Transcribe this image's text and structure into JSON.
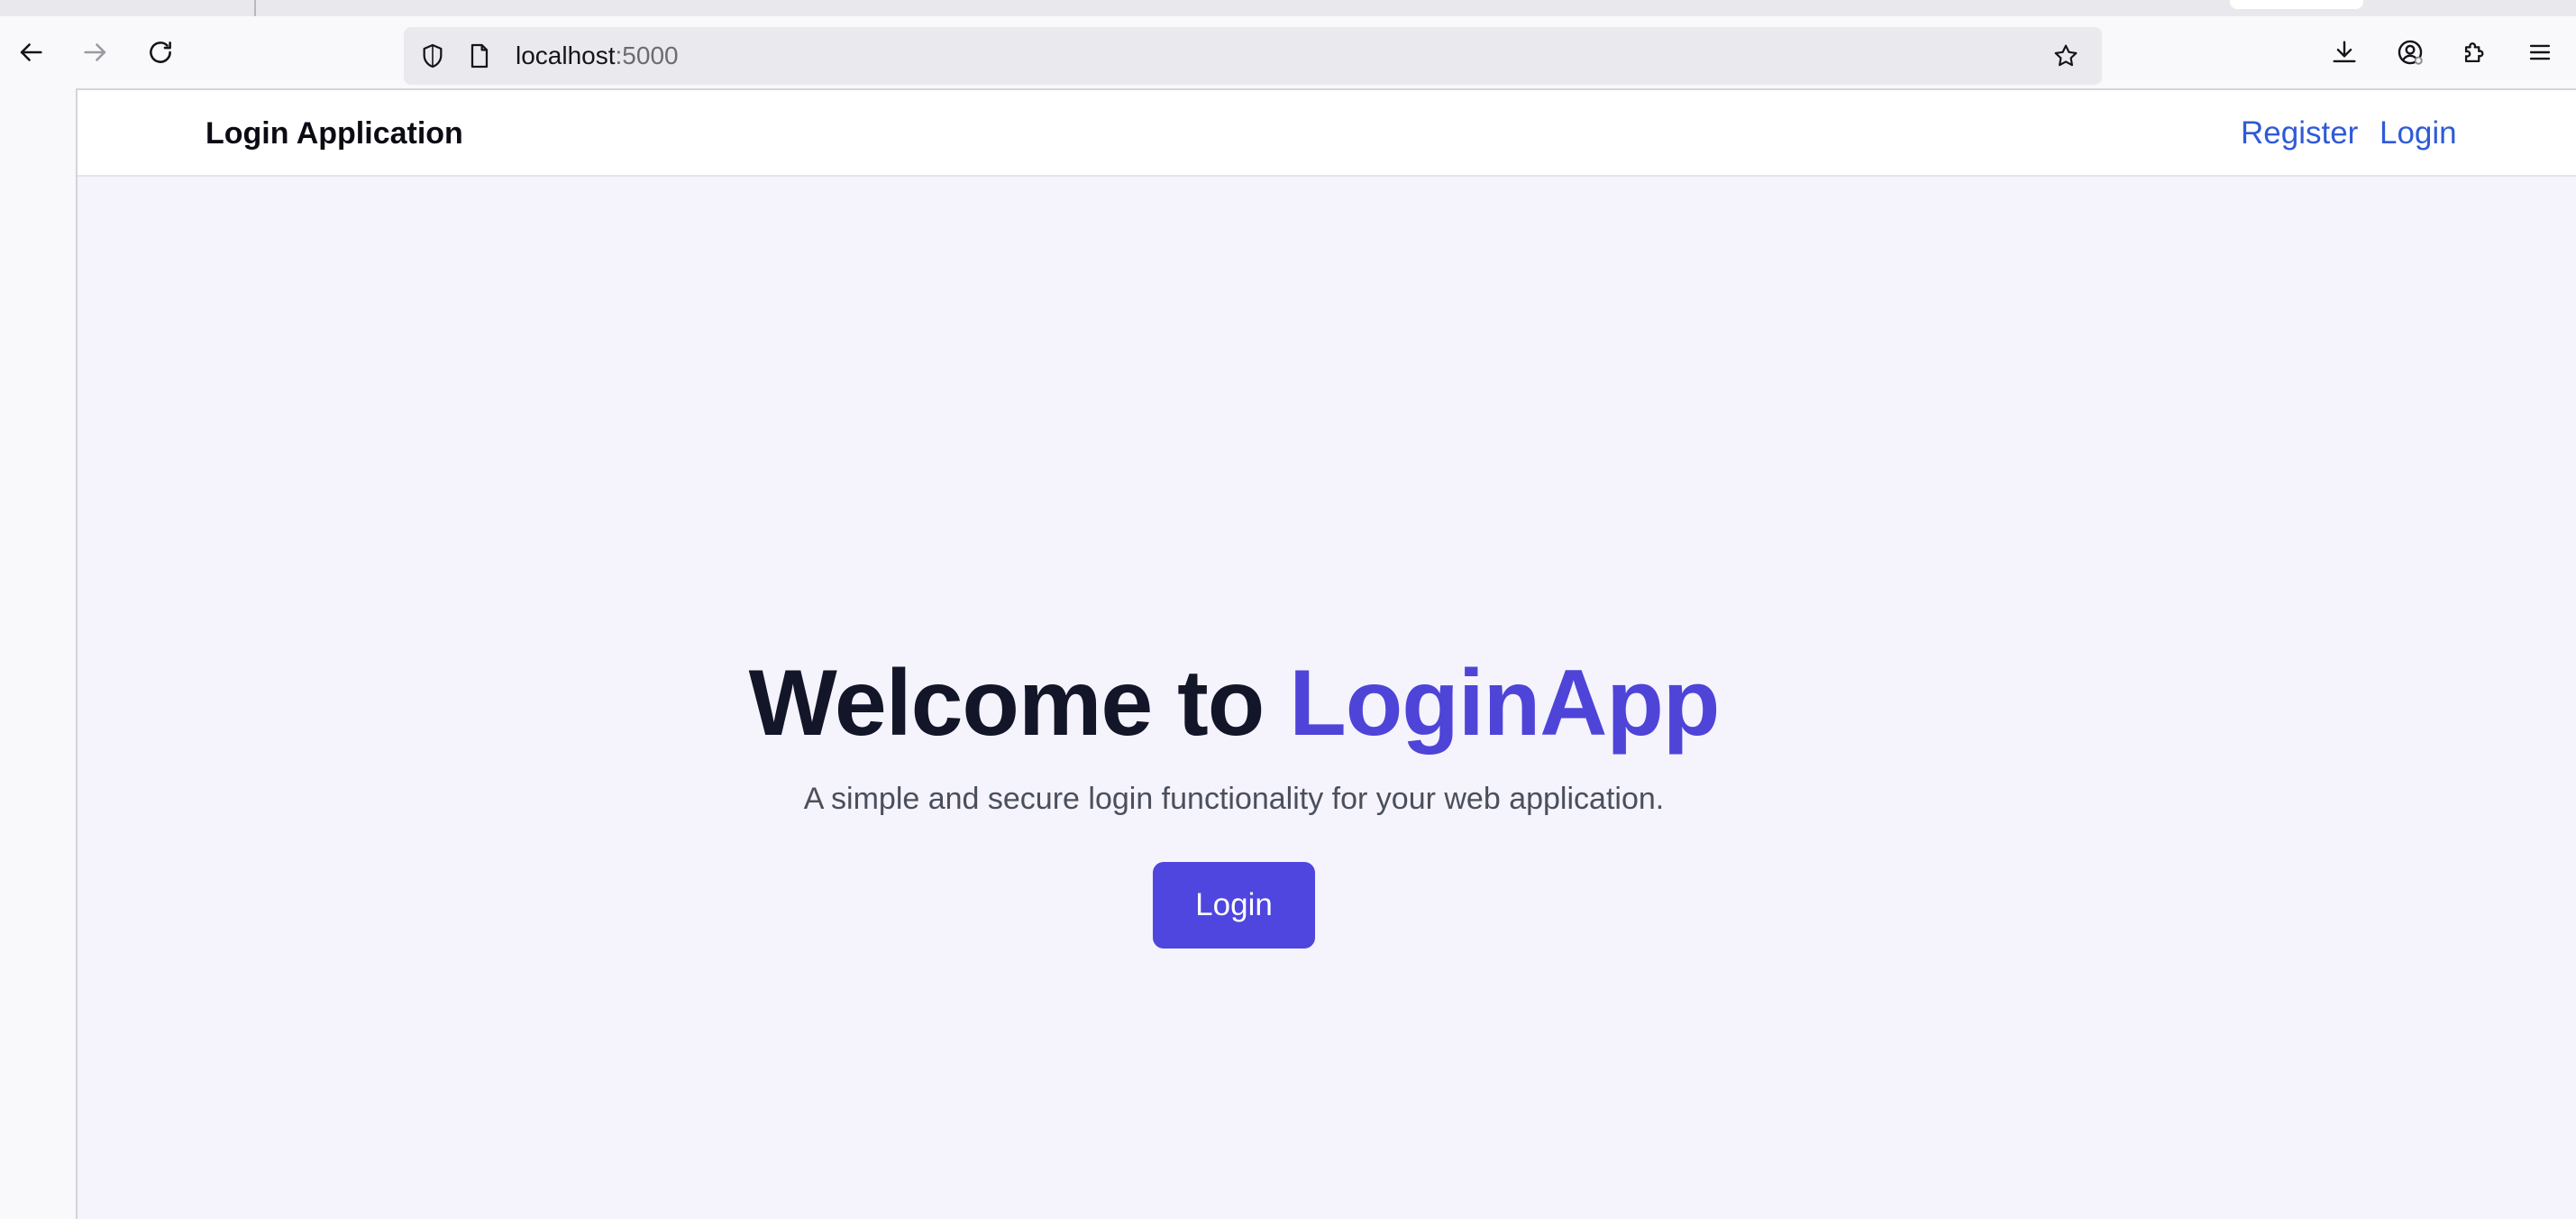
{
  "browser": {
    "url_host": "localhost",
    "url_port": ":5000",
    "icons": {
      "back": "back-arrow-icon",
      "forward": "forward-arrow-icon",
      "reload": "reload-icon",
      "shield": "shield-icon",
      "page": "page-icon",
      "bookmark": "star-icon",
      "downloads": "download-icon",
      "account": "account-icon",
      "extensions": "puzzle-icon",
      "menu": "hamburger-menu-icon"
    }
  },
  "site": {
    "brand": "Login Application",
    "nav": {
      "register": "Register",
      "login": "Login"
    },
    "hero": {
      "title_prefix": "Welcome to ",
      "title_accent": "LoginApp",
      "subtitle": "A simple and secure login functionality for your web application.",
      "button": "Login"
    }
  },
  "colors": {
    "accent": "#4f46e0",
    "link": "#2f5ad8",
    "page_bg": "#f5f3fc",
    "title": "#121628"
  }
}
